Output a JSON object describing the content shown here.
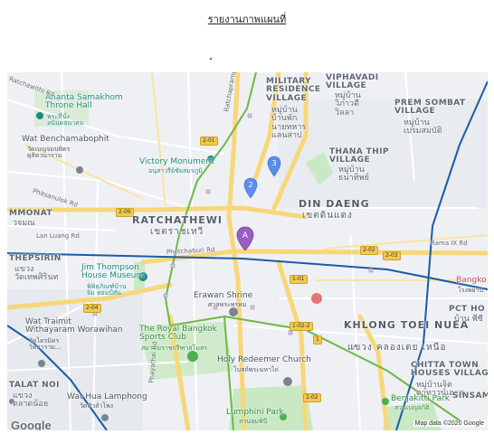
{
  "report": {
    "title": "รายงานภาพแผนที่"
  },
  "colors": {
    "map_bg": "#eef0f3",
    "major_road": "#f8d779",
    "green_line": "#6fb845",
    "blue_line": "#1c5aa6",
    "pin_primary": "#9b5fc0",
    "pin_secondary": "#5a8dee",
    "park": "#c9e9c4"
  },
  "map": {
    "districts": [
      {
        "en": "RATCHATHEWI",
        "th": "เขตราชเทวี"
      },
      {
        "en": "DIN DAENG",
        "th": "เขตดินแดง"
      },
      {
        "en": "KHLONG TOEI NUEA",
        "th": "แขวง คลองเตย เหนือ"
      }
    ],
    "areas": {
      "military_residence": {
        "en": [
          "MILITARY",
          "RESIDENCE",
          "VILLAGE"
        ],
        "th": [
          "หมู่บ้าน",
          "บ้านพัก",
          "นายทหาร",
          "แลนสาป"
        ]
      },
      "viphavadi": {
        "en": [
          "VIPHAVADI",
          "VILLAGE"
        ],
        "th": [
          "หมู่บ้าน",
          "วิภาวดี",
          "วิลลา"
        ]
      },
      "prem_sombat": {
        "en": [
          "PREM SOMBAT",
          "VILLAGE"
        ],
        "th": [
          "หมู่บ้าน",
          "เปรมสมบัติ"
        ]
      },
      "thana_thip": {
        "en": [
          "THANA THIP",
          "VILLAGE"
        ],
        "th": [
          "หมู่บ้าน",
          "ธนาทิพย์"
        ]
      },
      "thepsirin": {
        "en": [
          "THEPSIRIN"
        ],
        "th": [
          "แขวง",
          "วัดเทพศิรินท"
        ]
      },
      "wat_traimit": {
        "en": [
          "Wat Traimit",
          "Withayaram Worawihan"
        ],
        "th": [
          "วัดไตรมิตร",
          "วิทยาราม..."
        ]
      },
      "talat_noi": {
        "en": [
          "TALAT NOI"
        ],
        "th": [
          "แขวง",
          "ตลาดน้อย"
        ]
      },
      "chitta_town": {
        "en": [
          "CHITTA TOWN",
          "HOUSES VILLAGE"
        ],
        "th": [
          "หมู่บ้านจิต",
          "ตาทาวน์เฮาส"
        ]
      },
      "pct_house": {
        "en": [
          "PCT HO"
        ],
        "th": [
          "บ้าน พีซี"
        ]
      },
      "bangko": {
        "en": [
          "Bangko"
        ],
        "th": [
          "โรงพยาบ"
        ]
      },
      "sinsam": {
        "en": [
          "SINSAM"
        ]
      },
      "mmonat": {
        "en": [
          "MMONAT"
        ],
        "th": [
          "วจมณ"
        ]
      },
      "wat_benchamabophit": {
        "en": [
          "Wat Benchamabophit"
        ],
        "th": [
          "วัดเบญจมบพิตร",
          "ดุสิตวนาราม"
        ]
      }
    },
    "pois": {
      "ananta": {
        "en": [
          "Ananta Samakhom",
          "Throne Hall"
        ],
        "th": [
          "พระที่นั่ง",
          "อนันตสมาคม"
        ]
      },
      "victory": {
        "en": "Victory Monument",
        "th": "อนุสาวรีย์ชัยสมรภูมิ"
      },
      "jim_thompson": {
        "en": [
          "Jim Thompson",
          "House Museum"
        ],
        "th": [
          "พิพิธภัณฑ์บ้าน",
          "จิม ทอมป์สัน"
        ]
      },
      "erawan": {
        "en": "Erawan Shrine",
        "th": "ศาลพระพรหม"
      },
      "royal_bangkok": {
        "en": [
          "The Royal Bangkok",
          "Sports Club"
        ],
        "th": "สมาคมราชกรีฑาสโมสร"
      },
      "holy_redeemer": {
        "en": "Holy Redeemer Church",
        "th": "โบสถ์พระมหาไถ่"
      },
      "lumphini": {
        "en": "Lumphini Park",
        "th": "สวนลุมพินี"
      },
      "benjakitti": {
        "en": "Benjakitti Park",
        "th": "สวนเบญจกิติ"
      },
      "wat_hua_lamphong": {
        "en": "Wat Hua Lamphong",
        "th": "วัดหัวลำโพง"
      }
    },
    "roads": [
      "Ratchawithi Rd",
      "Phitsanulok Rd",
      "Lan Luang Rd",
      "Phetchaburi Rd",
      "Rama IX Rd",
      "Phayathai Rd",
      "Ratchaprarop Rd"
    ],
    "shields": [
      "2-01",
      "2-09",
      "2-02",
      "2-03",
      "1-01",
      "1-02-2",
      "1-02",
      "2-04",
      "1"
    ],
    "markers": {
      "primary": "A",
      "second": "2",
      "third": "3"
    },
    "google_logo": "Google",
    "attribution": "Map data ©2020 Google"
  }
}
